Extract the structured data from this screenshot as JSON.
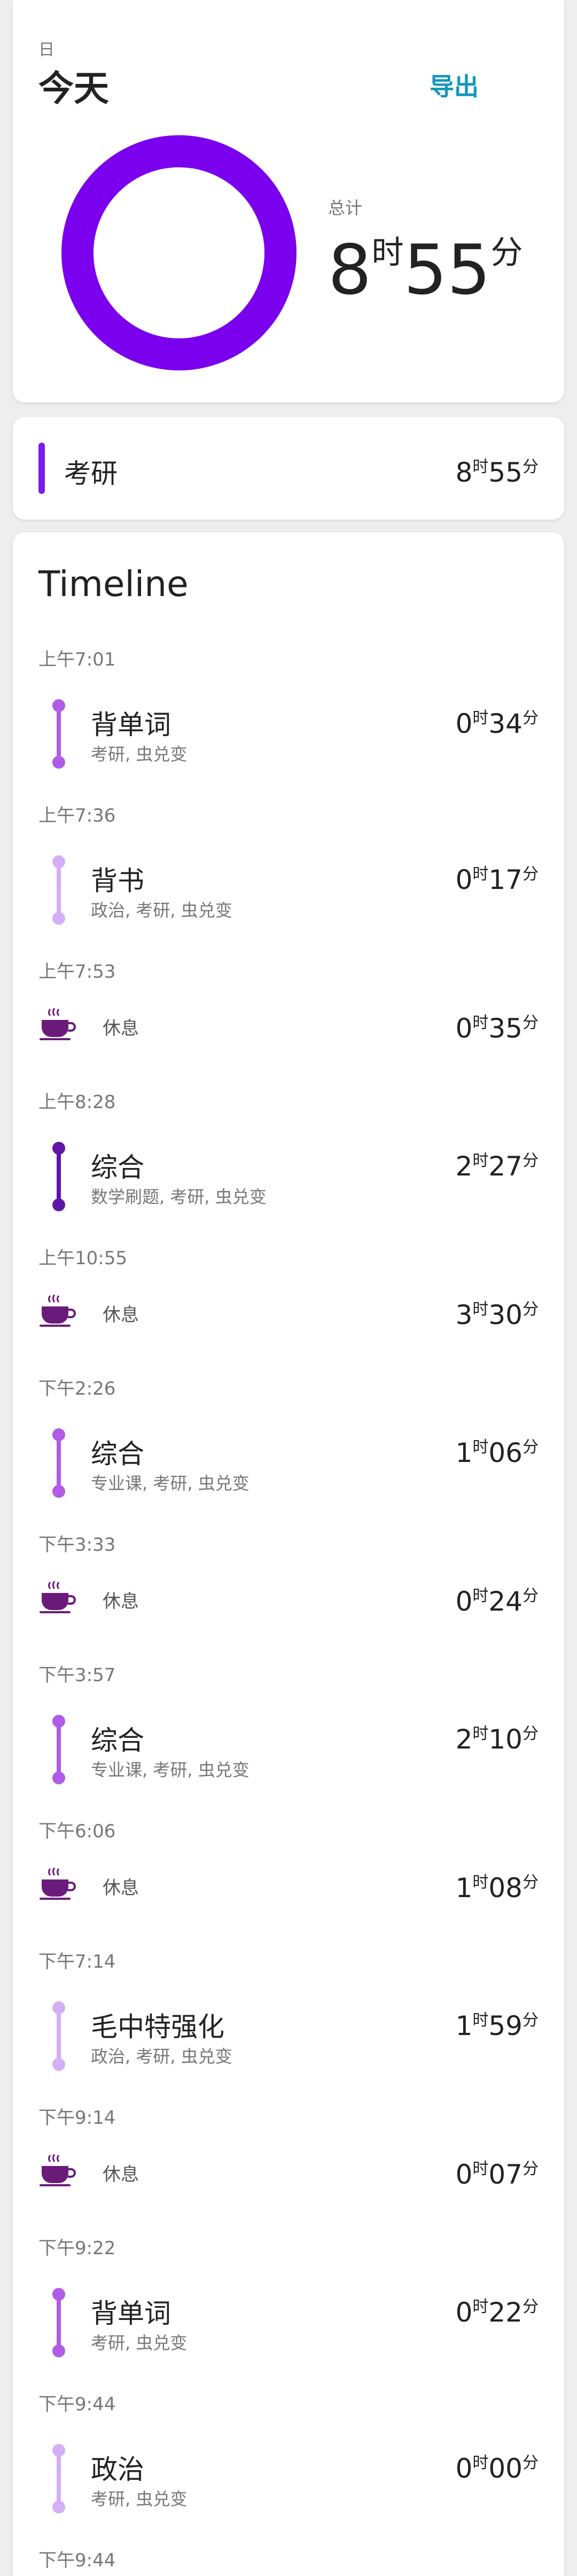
{
  "summary": {
    "period_label": "日",
    "period_title": "今天",
    "export_label": "导出",
    "total_label": "总计",
    "total": {
      "hours": "8",
      "hours_unit": "时",
      "minutes": "55",
      "minutes_unit": "分"
    },
    "donut_color": "#7a00ee"
  },
  "categories": [
    {
      "name": "考研",
      "hours": "8",
      "minutes": "55",
      "color": "#7a1cf0"
    }
  ],
  "timeline": {
    "heading": "Timeline",
    "units": {
      "hour": "时",
      "minute": "分"
    },
    "entries": [
      {
        "time": "上午7:01",
        "kind": "activity",
        "name": "背单词",
        "tags": "考研, 虫兑变",
        "hours": "0",
        "minutes": "34",
        "color": "#b05ce6"
      },
      {
        "time": "上午7:36",
        "kind": "activity",
        "name": "背书",
        "tags": "政治, 考研, 虫兑变",
        "hours": "0",
        "minutes": "17",
        "color": "#d4aef7"
      },
      {
        "time": "上午7:53",
        "kind": "break",
        "name": "休息",
        "hours": "0",
        "minutes": "35"
      },
      {
        "time": "上午8:28",
        "kind": "activity",
        "name": "综合",
        "tags": "数学刷题, 考研, 虫兑变",
        "hours": "2",
        "minutes": "27",
        "color": "#5f16a8"
      },
      {
        "time": "上午10:55",
        "kind": "break",
        "name": "休息",
        "hours": "3",
        "minutes": "30"
      },
      {
        "time": "下午2:26",
        "kind": "activity",
        "name": "综合",
        "tags": "专业课, 考研, 虫兑变",
        "hours": "1",
        "minutes": "06",
        "color": "#b05ce6"
      },
      {
        "time": "下午3:33",
        "kind": "break",
        "name": "休息",
        "hours": "0",
        "minutes": "24"
      },
      {
        "time": "下午3:57",
        "kind": "activity",
        "name": "综合",
        "tags": "专业课, 考研, 虫兑变",
        "hours": "2",
        "minutes": "10",
        "color": "#b05ce6"
      },
      {
        "time": "下午6:06",
        "kind": "break",
        "name": "休息",
        "hours": "1",
        "minutes": "08"
      },
      {
        "time": "下午7:14",
        "kind": "activity",
        "name": "毛中特强化",
        "tags": "政治, 考研, 虫兑变",
        "hours": "1",
        "minutes": "59",
        "color": "#d4aef7"
      },
      {
        "time": "下午9:14",
        "kind": "break",
        "name": "休息",
        "hours": "0",
        "minutes": "07"
      },
      {
        "time": "下午9:22",
        "kind": "activity",
        "name": "背单词",
        "tags": "考研, 虫兑变",
        "hours": "0",
        "minutes": "22",
        "color": "#b05ce6"
      },
      {
        "time": "下午9:44",
        "kind": "activity",
        "name": "政治",
        "tags": "考研, 虫兑变",
        "hours": "0",
        "minutes": "00",
        "color": "#d4aef7"
      }
    ],
    "end_time": "下午9:44",
    "break_cup_color": "#6a1b7a"
  }
}
